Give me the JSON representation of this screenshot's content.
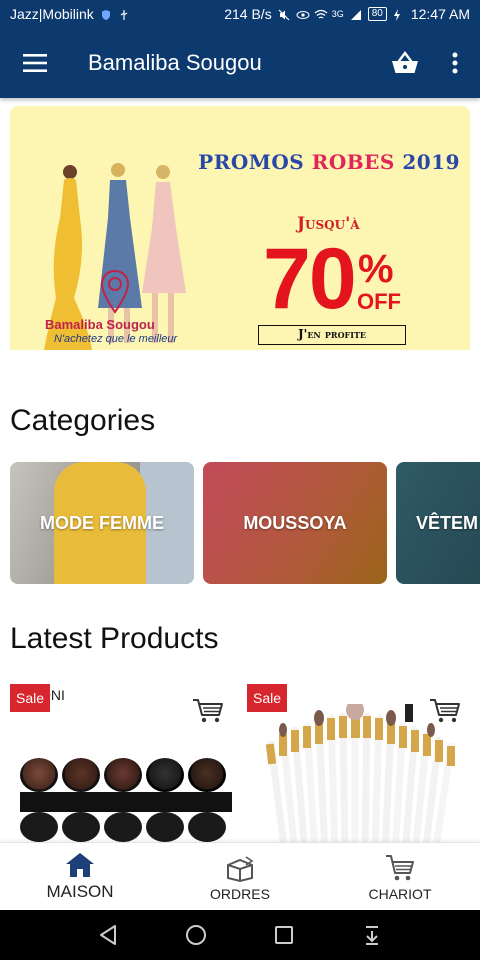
{
  "status_bar": {
    "carrier": "Jazz|Mobilink",
    "speed": "214 B/s",
    "network": "3G",
    "battery": "80",
    "time": "12:47 AM"
  },
  "app_bar": {
    "title": "Bamaliba Sougou",
    "icons": [
      "hamburger-menu-icon",
      "basket-icon",
      "more-vert-icon"
    ],
    "color": "#0d3a6e"
  },
  "banner": {
    "title_part1": "PROMOS",
    "title_part2": "ROBES",
    "title_part3": "2019",
    "jusqua": "Jusqu'à",
    "discount": "70",
    "percent": "%",
    "off": "OFF",
    "cta": "J'en profite",
    "brand": "Bamaliba Sougou",
    "tagline": "N'achetez que le meilleur"
  },
  "categories": {
    "heading": "Categories",
    "items": [
      {
        "label": "MODE FEMME"
      },
      {
        "label": "MOUSSOYA"
      },
      {
        "label": "VÊTEM FEMME"
      }
    ]
  },
  "products": {
    "heading": "Latest Products",
    "items": [
      {
        "badge": "Sale",
        "brand_text": "ONI"
      },
      {
        "badge": "Sale"
      }
    ]
  },
  "bottom_nav": {
    "items": [
      {
        "label": "MAISON",
        "icon": "home-icon",
        "active": true
      },
      {
        "label": "ORDRES",
        "icon": "box-icon",
        "active": false
      },
      {
        "label": "CHARIOT",
        "icon": "cart-icon",
        "active": false
      }
    ]
  },
  "colors": {
    "primary": "#0d3a6e",
    "sale_badge": "#d7262d",
    "promo_red": "#e3141e"
  }
}
